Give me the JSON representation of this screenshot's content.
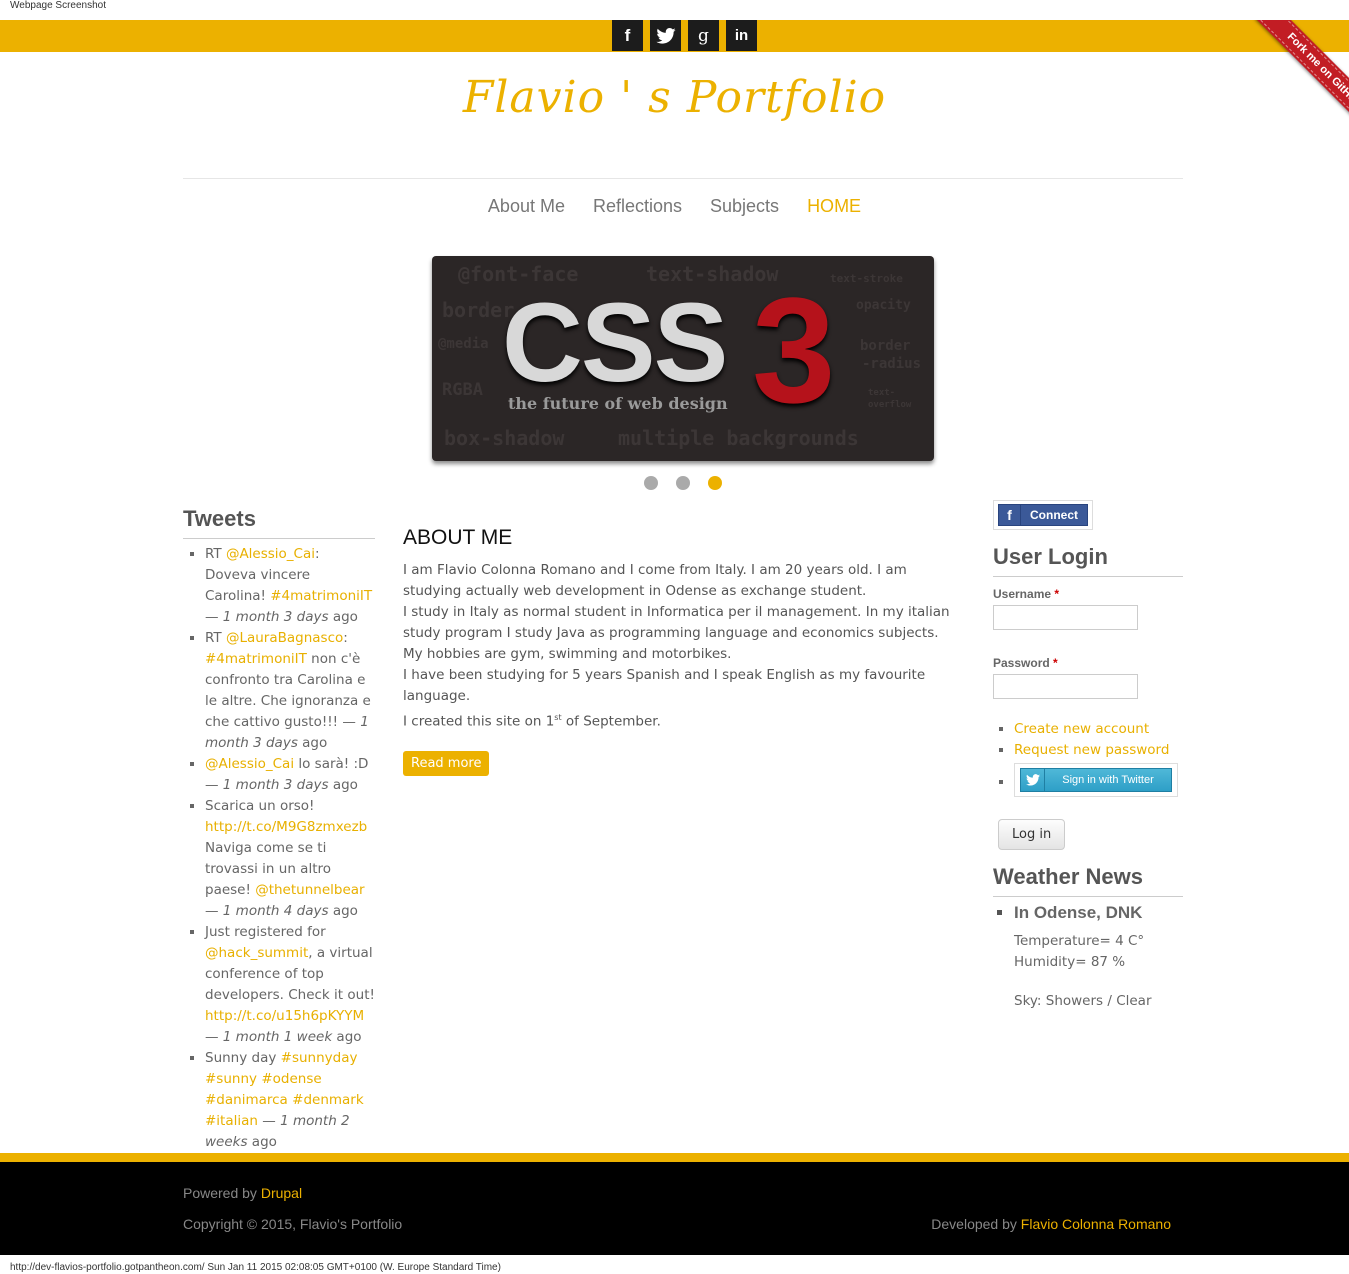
{
  "screenshot_caption": "Webpage Screenshot",
  "social": [
    {
      "icon": "facebook-icon",
      "glyph": "f"
    },
    {
      "icon": "twitter-icon",
      "glyph": ""
    },
    {
      "icon": "google-plus-icon",
      "glyph": "g"
    },
    {
      "icon": "linkedin-icon",
      "glyph": "in"
    }
  ],
  "fork_ribbon": "Fork me on GitHub",
  "site_title": "Flavio ' s Portfolio",
  "nav": {
    "about": "About Me",
    "reflections": "Reflections",
    "subjects": "Subjects",
    "home": "HOME"
  },
  "slider": {
    "main": "CSS",
    "number": "3",
    "tagline": "the future of web design",
    "bg_words": [
      "@font-face",
      "text-shadow",
      "text-stroke",
      "border",
      "opacity",
      "@media",
      "border",
      "-radius",
      "RGBA",
      "text-",
      "overflow",
      "box-shadow",
      "multiple backgrounds"
    ],
    "active_slide": 3,
    "slide_count": 3
  },
  "tweets": {
    "title": "Tweets",
    "items": [
      {
        "pre": "RT ",
        "link1": "@Alessio_Cai",
        "text1": ": Doveva vincere Carolina! ",
        "link2": "#4matrimoniIT",
        "sep": " — ",
        "time": "1 month 3 days",
        "ago": " ago"
      },
      {
        "pre": "RT ",
        "link1": "@LauraBagnasco",
        "text1": ": ",
        "link2": "#4matrimoniIT",
        "text2": " non c'è confronto tra Carolina e le altre. Che ignoranza e che cattivo gusto!!!",
        "sep": " — ",
        "time": "1 month 3 days",
        "ago": " ago"
      },
      {
        "link1": "@Alessio_Cai",
        "text1": " lo sarà! :D",
        "sep": " — ",
        "time": "1 month 3 days",
        "ago": " ago"
      },
      {
        "text0": "Scarica un orso! ",
        "link1": "http://t.co/M9G8zmxezb",
        "text1": " Naviga come se ti trovassi in un altro paese! ",
        "link2": "@thetunnelbear",
        "sep": " — ",
        "time": "1 month 4 days",
        "ago": " ago"
      },
      {
        "text0": "Just registered for ",
        "link1": "@hack_summit",
        "text1": ", a virtual conference of top developers. Check it out! ",
        "link2": "http://t.co/u15h6pKYYM",
        "sep": " — ",
        "time": "1 month 1 week",
        "ago": " ago"
      },
      {
        "text0": "Sunny day ",
        "link1": "#sunnyday",
        "text1": " ",
        "link2": "#sunny",
        "text2": " ",
        "link3": "#odense",
        "text3": " ",
        "link4": "#danimarca",
        "text4": " ",
        "link5": "#denmark",
        "text5": " ",
        "link6": "#italian",
        "sep": " — ",
        "time": "1 month 2 weeks",
        "ago": " ago"
      }
    ]
  },
  "about": {
    "title": "ABOUT ME",
    "lines": [
      "I am Flavio Colonna Romano and I come from Italy. I am 20 years old. I am studying actually web development in Odense as exchange student.",
      "I study in Italy as normal student in Informatica per il management. In my italian study program I study Java as programming language and economics subjects.",
      "My hobbies are gym, swimming and motorbikes.",
      "I have been studying for 5 years Spanish and I speak English as my favourite language."
    ],
    "last_line_pre": "I created this site on 1",
    "last_line_sup": "st",
    "last_line_post": " of September.",
    "read_more": "Read more"
  },
  "login": {
    "facebook_connect": "Connect",
    "title": "User Login",
    "username_label": "Username",
    "password_label": "Password",
    "required_mark": "*",
    "username_value": "",
    "password_value": "",
    "create_account": "Create new account",
    "request_password": "Request new password",
    "twitter_signin": "Sign in with Twitter",
    "submit": "Log in"
  },
  "weather": {
    "title": "Weather News",
    "place": "In Odense, DNK",
    "temperature": "Temperature= 4 C°",
    "humidity": "Humidity= 87 %",
    "sky": "Sky: Showers / Clear"
  },
  "footer": {
    "powered_by": "Powered by ",
    "powered_link": "Drupal",
    "copyright": "Copyright © 2015, Flavio's Portfolio",
    "developed_by": "Developed by ",
    "developer": "Flavio Colonna Romano"
  },
  "url_bar": "http://dev-flavios-portfolio.gotpantheon.com/ Sun Jan 11 2015 02:08:05 GMT+0100 (W. Europe Standard Time)",
  "colors": {
    "accent": "#ecb100",
    "footer_bg": "#000000",
    "ribbon": "#c21d24"
  }
}
